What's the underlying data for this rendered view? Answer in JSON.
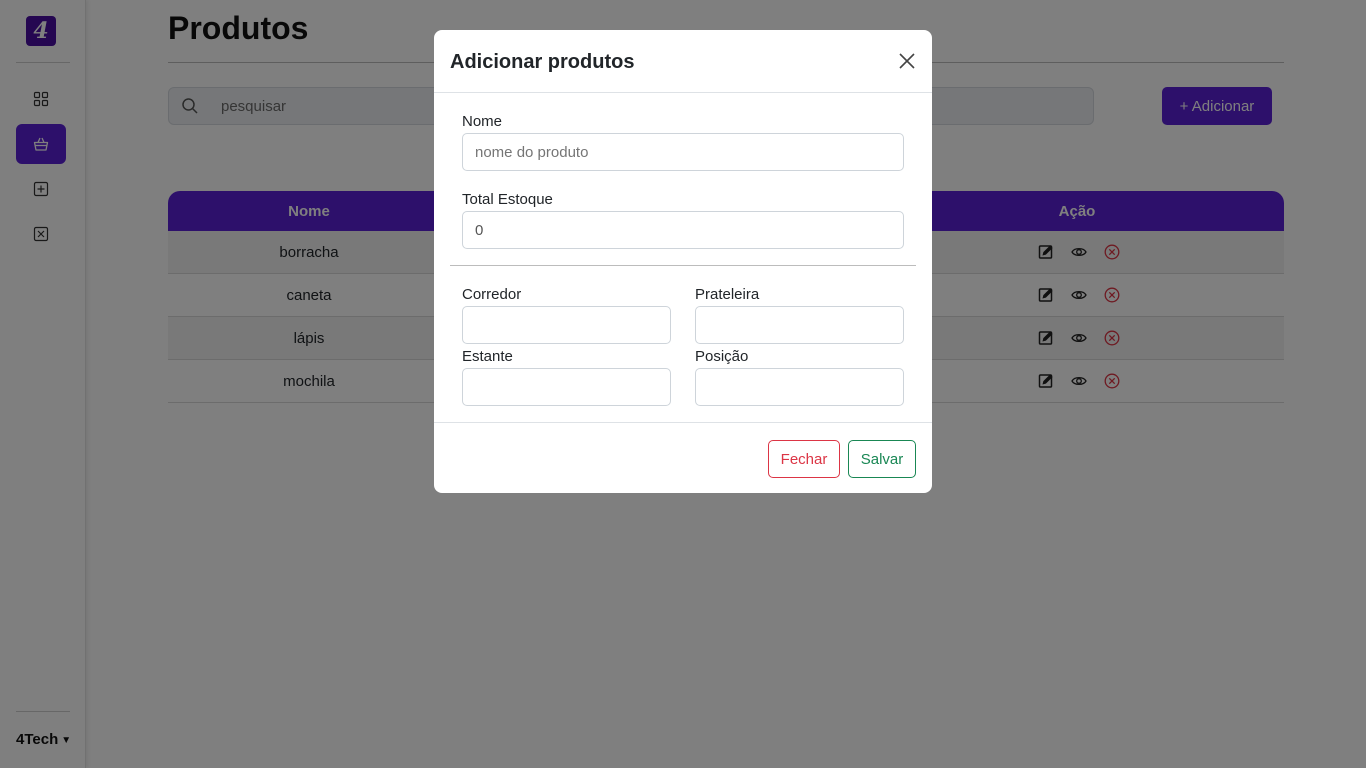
{
  "sidebar": {
    "logo_text": "4",
    "user_name": "4Tech",
    "items": [
      {
        "name": "dashboard",
        "icon": "grid-icon",
        "active": false
      },
      {
        "name": "produtos",
        "icon": "basket-icon",
        "active": true
      },
      {
        "name": "adicionar",
        "icon": "plus-square-icon",
        "active": false
      },
      {
        "name": "remover",
        "icon": "x-square-icon",
        "active": false
      }
    ]
  },
  "page": {
    "title": "Produtos",
    "search_placeholder": "pesquisar",
    "add_button": "+ Adicionar"
  },
  "table": {
    "columns": [
      "Nome",
      "Ação"
    ],
    "rows": [
      {
        "name": "borracha"
      },
      {
        "name": "caneta"
      },
      {
        "name": "lápis"
      },
      {
        "name": "mochila"
      }
    ],
    "action_icons": [
      "edit-icon",
      "eye-icon",
      "delete-circle-x-icon"
    ]
  },
  "modal": {
    "title": "Adicionar produtos",
    "nome_label": "Nome",
    "nome_placeholder": "nome do produto",
    "estoque_label": "Total Estoque",
    "estoque_value": "0",
    "corredor_label": "Corredor",
    "prateleira_label": "Prateleira",
    "estante_label": "Estante",
    "posicao_label": "Posição",
    "fechar_button": "Fechar",
    "salvar_button": "Salvar"
  },
  "colors": {
    "primary": "#5b21d6",
    "logo": "#4a0fa3",
    "danger": "#dc3545",
    "success": "#198754"
  }
}
